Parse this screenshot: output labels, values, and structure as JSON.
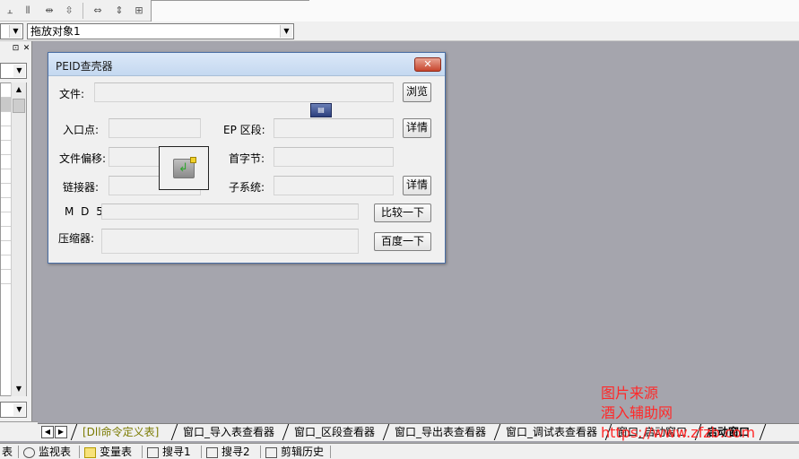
{
  "toolbar_top": {
    "icons": [
      "align-top-icon",
      "distribute-horizontal-icon",
      "space-horizontal-icon",
      "space-vertical-icon",
      "same-width-icon",
      "same-height-icon",
      "same-size-icon"
    ]
  },
  "toolbar_second": {
    "combo_left_value": "",
    "combo_main_value": "拖放对象1"
  },
  "left_panel": {
    "header_buttons": [
      "⊡",
      "✕"
    ],
    "list_rows": 14
  },
  "dialog": {
    "title": "PEID查壳器",
    "close_label": "✕",
    "labels": {
      "file": "文件:",
      "entry_point": "入口点:",
      "ep_section": "EP 区段:",
      "file_offset": "文件偏移:",
      "first_byte": "首字节:",
      "linker": "链接器:",
      "subsystem": "子系统:",
      "md5": "M D 5:",
      "packer": "压缩器:"
    },
    "buttons": {
      "browse": "浏览",
      "details1": "详情",
      "details2": "详情",
      "compare": "比较一下",
      "baidu": "百度一下"
    },
    "values": {
      "file": "",
      "entry_point": "",
      "ep_section": "",
      "file_offset": "",
      "first_byte": "",
      "linker": "",
      "subsystem": "",
      "md5": "",
      "packer": ""
    }
  },
  "tabs": [
    {
      "label": "[Dll命令定义表]"
    },
    {
      "label": "窗口_导入表查看器"
    },
    {
      "label": "窗口_区段查看器"
    },
    {
      "label": "窗口_导出表查看器"
    },
    {
      "label": "窗口_调试表查看器"
    },
    {
      "label": "窗口_启动窗口"
    },
    {
      "label": "启动窗口"
    }
  ],
  "bottom_toolbar": [
    {
      "icon": "list-icon",
      "label": "表"
    },
    {
      "icon": "magnifier-icon",
      "label": "监视表"
    },
    {
      "icon": "variable-icon",
      "label": "变量表"
    },
    {
      "icon": "search1-icon",
      "label": "搜寻1"
    },
    {
      "icon": "search2-icon",
      "label": "搜寻2"
    },
    {
      "icon": "clipboard-icon",
      "label": "剪辑历史"
    }
  ],
  "watermark": {
    "line1": "图片来源",
    "line2": "酒入辅助网",
    "line3": "https://www.zfzb.com"
  },
  "colors": {
    "workspace": "#a5a5ad",
    "watermark": "#ff2a2a",
    "close_button": "#c7452d"
  }
}
